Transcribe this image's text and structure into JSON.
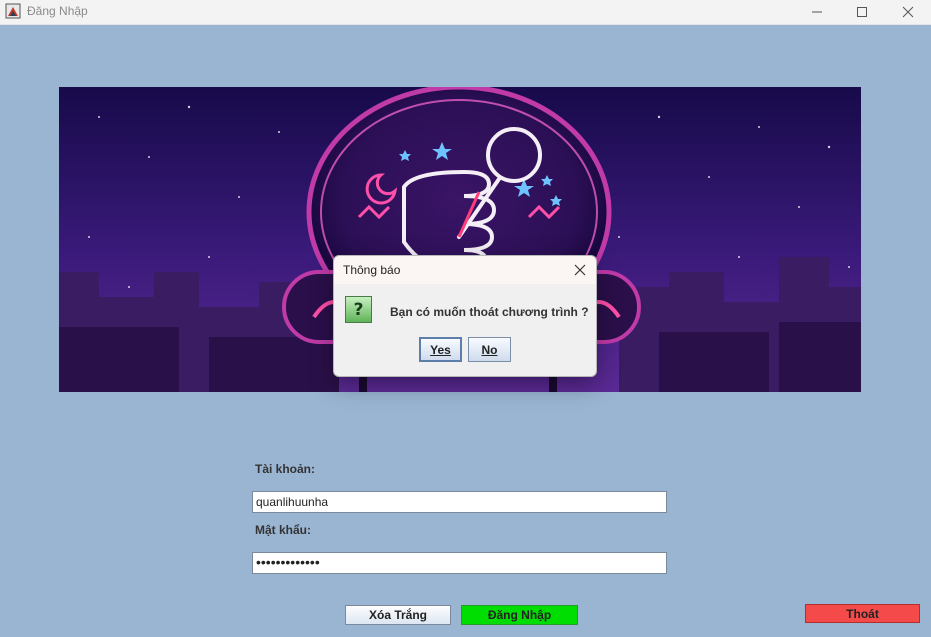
{
  "window": {
    "title": "Đăng Nhập",
    "icons": [
      "app-icon",
      "minimize-icon",
      "maximize-icon",
      "close-icon"
    ]
  },
  "login_form": {
    "username_label": "Tài khoản:",
    "username_value": "quanlihuunha",
    "password_label": "Mật khẩu:",
    "password_value": "•••••••••••••"
  },
  "buttons": {
    "clear_label": "Xóa Trắng",
    "login_label": "Đăng Nhập",
    "exit_label": "Thoát"
  },
  "dialog": {
    "title": "Thông báo",
    "message": "Bạn có muốn thoát chương trình ?",
    "yes_label": "Yes",
    "no_label": "No",
    "icon_glyph": "?"
  },
  "colors": {
    "background": "#9ab5d2",
    "login_button": "#00dd00",
    "exit_button": "#f44a4a",
    "banner_sky": "#2a1160"
  }
}
